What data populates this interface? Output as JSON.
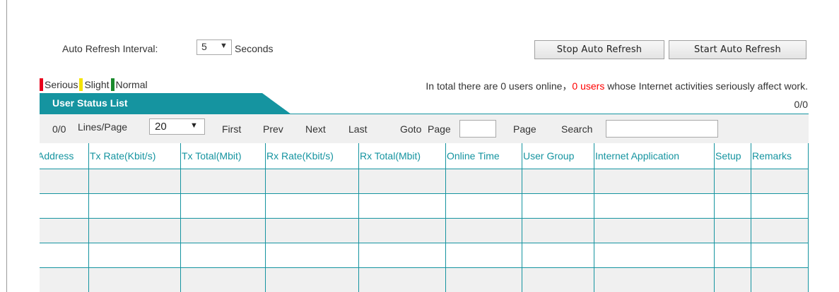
{
  "refresh": {
    "label": "Auto Refresh Interval:",
    "interval_value": "5",
    "arrow": "▼",
    "unit": "Seconds",
    "stop_label": "Stop Auto Refresh",
    "start_label": "Start Auto Refresh"
  },
  "legend": {
    "items": [
      {
        "label": "Serious",
        "color": "#e8001c"
      },
      {
        "label": "Slight",
        "color": "#f4e300"
      },
      {
        "label": "Normal",
        "color": "#1a8a2c"
      }
    ]
  },
  "summary": {
    "prefix": "In total there are 0 users online，",
    "highlight": "0 users",
    "suffix": " whose Internet activities seriously affect work."
  },
  "tab": {
    "title": "User Status List",
    "count": "0/0"
  },
  "toolbar": {
    "count": "0/0",
    "lines_label": "Lines/Page",
    "lines_value": "20",
    "arrow": "▼",
    "first": "First",
    "prev": "Prev",
    "next": "Next",
    "last": "Last",
    "goto": "Goto",
    "page1": "Page",
    "page2": "Page",
    "search": "Search"
  },
  "table": {
    "columns": [
      "Address",
      "Tx Rate(Kbit/s)",
      "Tx Total(Mbit)",
      "Rx Rate(Kbit/s)",
      "Rx Total(Mbit)",
      "Online Time",
      "User Group",
      "Internet Application",
      "Setup",
      "Remarks"
    ],
    "empty_rows": 5
  },
  "colors": {
    "accent": "#1594a0",
    "alert": "#ff0000",
    "row_shade": "#f0f0f0"
  }
}
